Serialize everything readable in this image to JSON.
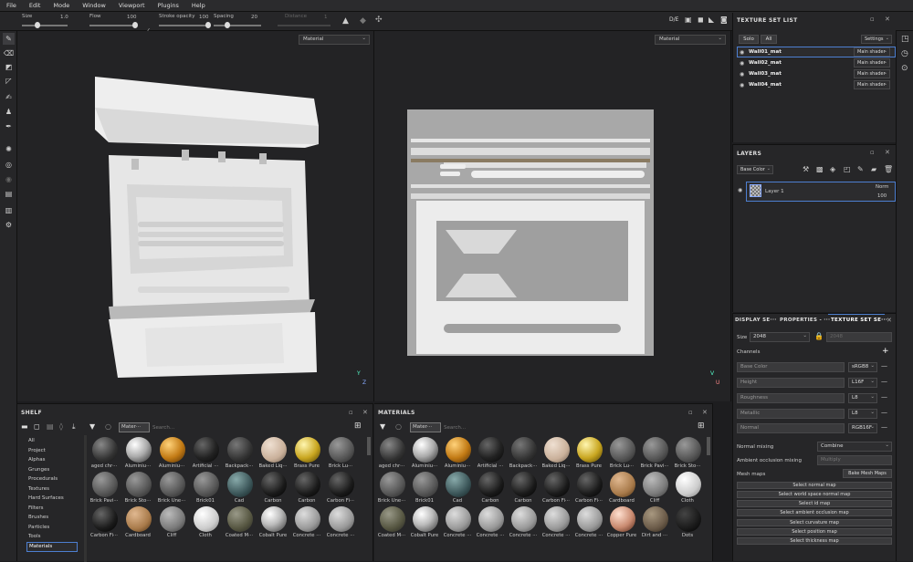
{
  "menu": [
    "File",
    "Edit",
    "Mode",
    "Window",
    "Viewport",
    "Plugins",
    "Help"
  ],
  "tool_options": {
    "size_label": "Size",
    "size_value": "1.0",
    "flow_label": "Flow",
    "flow_value": "100",
    "stroke_opacity_label": "Stroke opacity",
    "stroke_opacity_value": "100",
    "spacing_label": "Spacing",
    "spacing_value": "20",
    "distance_label": "Distance",
    "distance_value": "1"
  },
  "viewport_left_mode": "Material",
  "viewport_right_mode": "Material",
  "view_mode": "D/E",
  "texture_set_list": {
    "title": "TEXTURE SET LIST",
    "solo": "Solo",
    "all": "All",
    "settings": "Settings",
    "items": [
      {
        "name": "Wall01_mat",
        "shader": "Main shader"
      },
      {
        "name": "Wall02_mat",
        "shader": "Main shader"
      },
      {
        "name": "Wall03_mat",
        "shader": "Main shader"
      },
      {
        "name": "Wall04_mat",
        "shader": "Main shader"
      }
    ]
  },
  "layers": {
    "title": "LAYERS",
    "channel": "Base Color",
    "layer_name": "Layer 1",
    "blend": "Norm",
    "opacity": "100"
  },
  "tabs": [
    "DISPLAY SE···",
    "PROPERTIES - ···",
    "TEXTURE SET SE···"
  ],
  "texture_set_settings": {
    "size_label": "Size",
    "size_value": "2048",
    "size_value2": "2048",
    "channels_label": "Channels",
    "channels": [
      {
        "name": "Base Color",
        "format": "sRGB8"
      },
      {
        "name": "Height",
        "format": "L16F"
      },
      {
        "name": "Roughness",
        "format": "L8"
      },
      {
        "name": "Metallic",
        "format": "L8"
      },
      {
        "name": "Normal",
        "format": "RGB16F"
      }
    ],
    "normal_mixing_label": "Normal mixing",
    "normal_mixing_value": "Combine",
    "ao_mixing_label": "Ambient occlusion mixing",
    "ao_mixing_value": "Multiply",
    "mesh_maps_label": "Mesh maps",
    "bake_button": "Bake Mesh Maps",
    "maps": [
      "Select normal map",
      "Select world space normal map",
      "Select id map",
      "Select ambient occlusion map",
      "Select curvature map",
      "Select position map",
      "Select thickness map"
    ]
  },
  "shelf": {
    "title": "SHELF",
    "filter_tag": "Mater···",
    "search_placeholder": "Search...",
    "categories": [
      "All",
      "Project",
      "Alphas",
      "Grunges",
      "Procedurals",
      "Textures",
      "Hard Surfaces",
      "Filters",
      "Brushes",
      "Particles",
      "Tools",
      "Materials"
    ],
    "row1": [
      "aged chr···",
      "Aluminiu···",
      "Aluminiu···",
      "Artificial ···",
      "Backpack···",
      "Baked Liq···",
      "Brass Pure",
      "Brick Lu···"
    ],
    "row2": [
      "Brick Pavi···",
      "Brick Sto···",
      "Brick Une···",
      "Brick01",
      "Cad",
      "Carbon",
      "Carbon",
      "Carbon Fi···"
    ],
    "row3": [
      "Carbon Fi···",
      "Cardboard",
      "Cliff",
      "Cloth",
      "Coated M···",
      "Cobalt Pure",
      "Concrete ···",
      "Concrete ···"
    ]
  },
  "materials": {
    "title": "MATERIALS",
    "filter_tag": "Mater···",
    "search_placeholder": "Search...",
    "row1": [
      "aged chr···",
      "Aluminiu···",
      "Aluminiu···",
      "Artificial ···",
      "Backpack···",
      "Baked Liq···",
      "Brass Pure",
      "Brick Lu···",
      "Brick Pavi···",
      "Brick Sto···"
    ],
    "row2": [
      "Brick Une···",
      "Brick01",
      "Cad",
      "Carbon",
      "Carbon",
      "Carbon Fi···",
      "Carbon Fi···",
      "Cardboard",
      "Cliff",
      "Cloth"
    ],
    "row3": [
      "Coated M···",
      "Cobalt Pure",
      "Concrete ···",
      "Concrete ···",
      "Concrete ···",
      "Concrete ···",
      "Concrete ···",
      "Copper Pure",
      "Dirt and ···",
      "Dots"
    ]
  }
}
